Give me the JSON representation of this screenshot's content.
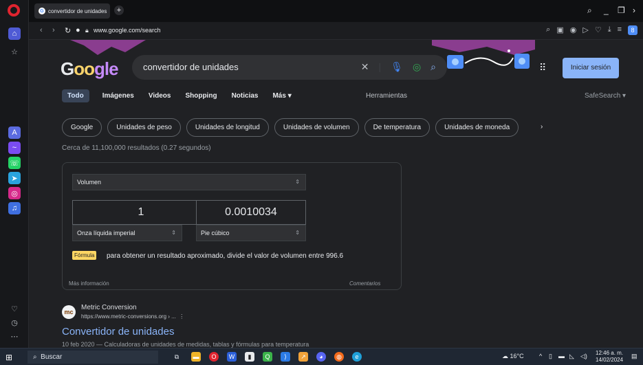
{
  "browser": {
    "tab_title": "convertidor de unidades",
    "url": "www.google.com/search"
  },
  "header": {
    "logo_text": "Google",
    "query": "convertidor de unidades",
    "signin_label": "Iniciar sesión"
  },
  "nav_tabs": [
    "Todo",
    "Imágenes",
    "Videos",
    "Shopping",
    "Noticias",
    "Más"
  ],
  "tools_label": "Herramientas",
  "safesearch_label": "SafeSearch",
  "chips": [
    "Google",
    "Unidades de peso",
    "Unidades de longitud",
    "Unidades de volumen",
    "De temperatura",
    "Unidades de moneda"
  ],
  "stats": "Cerca de 11,100,000 resultados (0.27 segundos)",
  "converter": {
    "category": "Volumen",
    "from_value": "1",
    "to_value": "0.0010034",
    "equals": "=",
    "from_unit": "Onza líquida imperial",
    "to_unit": "Pie cúbico",
    "formula_badge": "Fórmula",
    "formula_text": "para obtener un resultado aproximado, divide el valor de volumen entre 996.6",
    "more_info": "Más información",
    "feedback": "Comentarios"
  },
  "result": {
    "site_name": "Metric Conversion",
    "site_url": "https://www.metric-conversions.org › ...",
    "title": "Convertidor de unidades",
    "snippet": "10 feb 2020 — Calculadoras de unidades de medidas, tablas y fórmulas para temperatura"
  },
  "taskbar": {
    "search_label": "Buscar",
    "weather": "16°C",
    "time": "12:46 a. m.",
    "date": "14/02/2024"
  },
  "colors": {
    "background": "#202124",
    "accent": "#8ab4f8",
    "formula_badge": "#fdd663"
  }
}
